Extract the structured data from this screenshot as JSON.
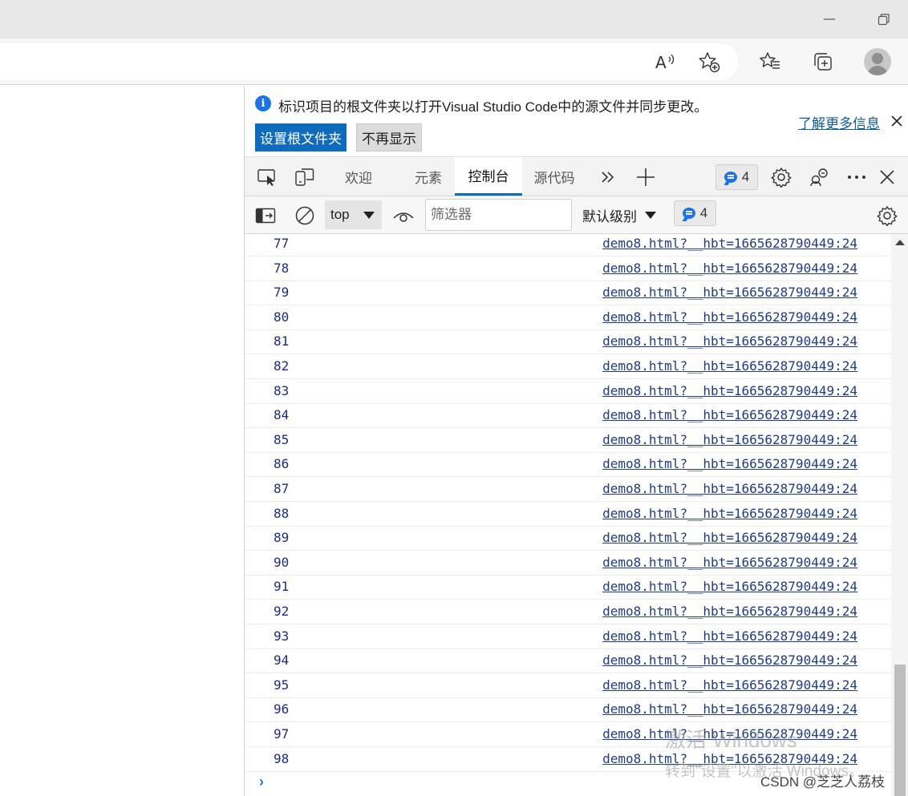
{
  "window": {
    "minimize_icon": "minimize-icon",
    "restore_icon": "restore-icon"
  },
  "toolbar": {
    "icons": [
      "read-aloud-icon",
      "add-favorite-icon",
      "favorites-icon",
      "collections-icon",
      "profile-avatar"
    ]
  },
  "devtools": {
    "infobar": {
      "message": "标识项目的根文件夹以打开Visual Studio Code中的源文件并同步更改。",
      "set_root_button": "设置根文件夹",
      "dont_show_button": "不再显示",
      "learn_more_link": "了解更多信息"
    },
    "tabs": [
      {
        "label": "欢迎",
        "active": false
      },
      {
        "label": "元素",
        "active": false
      },
      {
        "label": "控制台",
        "active": true
      },
      {
        "label": "源代码",
        "active": false
      }
    ],
    "issues_count": "4",
    "console_toolbar": {
      "context": "top",
      "filter_placeholder": "筛选器",
      "level": "默认级别",
      "message_count": "4"
    },
    "log_rows": [
      {
        "value": "77",
        "source": "demo8.html?__hbt=1665628790449:24"
      },
      {
        "value": "78",
        "source": "demo8.html?__hbt=1665628790449:24"
      },
      {
        "value": "79",
        "source": "demo8.html?__hbt=1665628790449:24"
      },
      {
        "value": "80",
        "source": "demo8.html?__hbt=1665628790449:24"
      },
      {
        "value": "81",
        "source": "demo8.html?__hbt=1665628790449:24"
      },
      {
        "value": "82",
        "source": "demo8.html?__hbt=1665628790449:24"
      },
      {
        "value": "83",
        "source": "demo8.html?__hbt=1665628790449:24"
      },
      {
        "value": "84",
        "source": "demo8.html?__hbt=1665628790449:24"
      },
      {
        "value": "85",
        "source": "demo8.html?__hbt=1665628790449:24"
      },
      {
        "value": "86",
        "source": "demo8.html?__hbt=1665628790449:24"
      },
      {
        "value": "87",
        "source": "demo8.html?__hbt=1665628790449:24"
      },
      {
        "value": "88",
        "source": "demo8.html?__hbt=1665628790449:24"
      },
      {
        "value": "89",
        "source": "demo8.html?__hbt=1665628790449:24"
      },
      {
        "value": "90",
        "source": "demo8.html?__hbt=1665628790449:24"
      },
      {
        "value": "91",
        "source": "demo8.html?__hbt=1665628790449:24"
      },
      {
        "value": "92",
        "source": "demo8.html?__hbt=1665628790449:24"
      },
      {
        "value": "93",
        "source": "demo8.html?__hbt=1665628790449:24"
      },
      {
        "value": "94",
        "source": "demo8.html?__hbt=1665628790449:24"
      },
      {
        "value": "95",
        "source": "demo8.html?__hbt=1665628790449:24"
      },
      {
        "value": "96",
        "source": "demo8.html?__hbt=1665628790449:24"
      },
      {
        "value": "97",
        "source": "demo8.html?__hbt=1665628790449:24"
      },
      {
        "value": "98",
        "source": "demo8.html?__hbt=1665628790449:24"
      }
    ],
    "prompt": "›"
  },
  "overlay": {
    "activate_title": "激活 Windows",
    "activate_hint": "转到\"设置\"以激活 Windows。",
    "credit": "CSDN @芝芝人荔枝"
  },
  "colors": {
    "accent": "#0f6cbd",
    "link": "#1f3c8c",
    "log_number": "#1c2a8a",
    "info_blue": "#1a73e8"
  }
}
